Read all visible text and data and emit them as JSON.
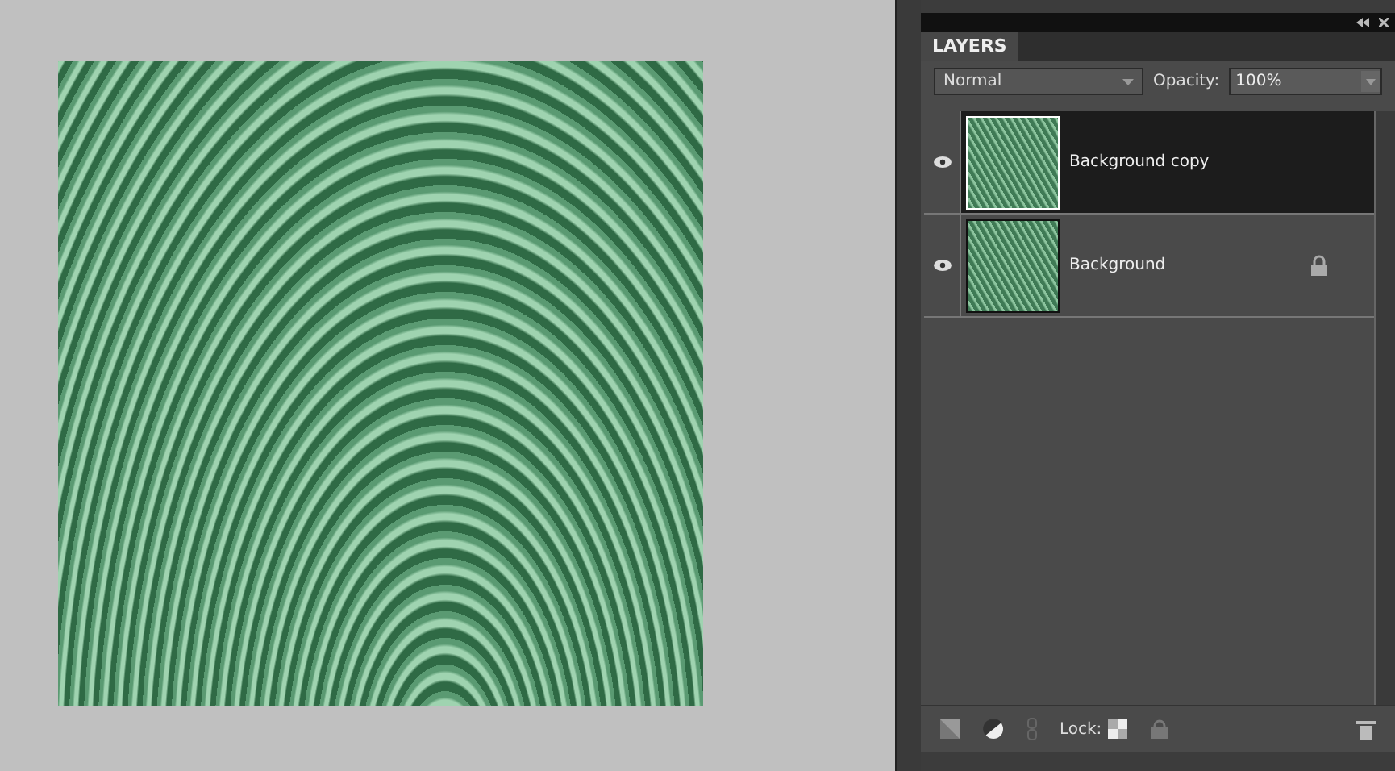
{
  "panel": {
    "tab": "LAYERS",
    "blend_mode": "Normal",
    "opacity_label": "Opacity:",
    "opacity": "100%"
  },
  "layers": [
    {
      "name": "Background copy",
      "selected": true,
      "visible": true,
      "locked": false
    },
    {
      "name": "Background",
      "selected": false,
      "visible": true,
      "locked": true
    }
  ],
  "footer": {
    "lock_label": "Lock:"
  }
}
